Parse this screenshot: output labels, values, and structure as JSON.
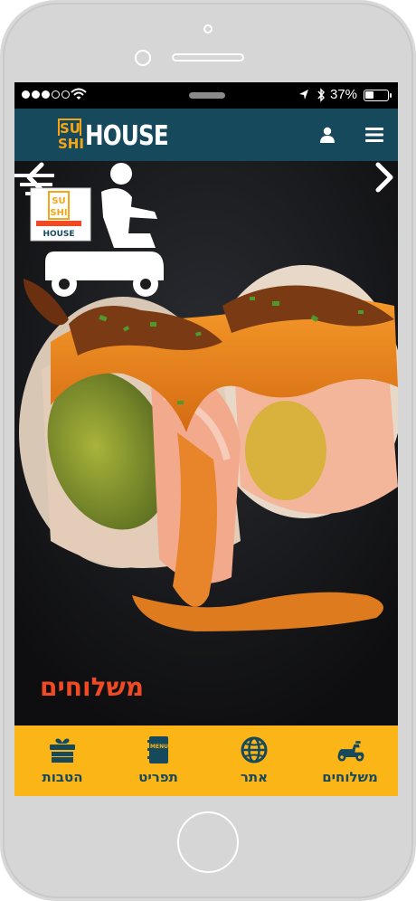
{
  "status_bar": {
    "signal_dots_full": 3,
    "signal_dots_total": 5,
    "battery_text": "37%",
    "battery_level": 0.37
  },
  "header": {
    "logo_top": "SU",
    "logo_bottom": "SHI",
    "logo_word": "HOUSE",
    "user_icon": "user-icon",
    "menu_icon": "hamburger-menu-icon"
  },
  "hero": {
    "prev_icon": "chevron-left-icon",
    "next_icon": "chevron-right-icon",
    "promo_label": "משלוחים",
    "promo_logo_top": "SU",
    "promo_logo_bottom": "SHI",
    "promo_logo_word": "HOUSE"
  },
  "tabs": [
    {
      "label": "משלוחים",
      "icon": "scooter-icon"
    },
    {
      "label": "אתר",
      "icon": "globe-icon"
    },
    {
      "label": "תפריט",
      "icon": "menu-book-icon",
      "icon_text": "MENU"
    },
    {
      "label": "הטבות",
      "icon": "gift-icon"
    }
  ],
  "colors": {
    "header_bg": "#17495d",
    "accent_orange": "#f6a514",
    "tabbar_bg": "#fbb517",
    "tab_text": "#17495d",
    "promo_red": "#ef4a24"
  }
}
